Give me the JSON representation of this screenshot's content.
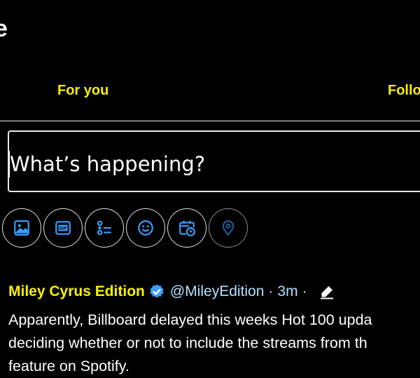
{
  "header": {
    "title": "e"
  },
  "tabs": [
    {
      "label": "For you"
    },
    {
      "label": "Follo"
    }
  ],
  "compose": {
    "placeholder": "What’s happening?",
    "toolbar": [
      {
        "icon": "image-icon",
        "label": "Media"
      },
      {
        "icon": "gif-icon",
        "label": "GIF"
      },
      {
        "icon": "poll-icon",
        "label": "Poll"
      },
      {
        "icon": "emoji-icon",
        "label": "Emoji"
      },
      {
        "icon": "schedule-icon",
        "label": "Schedule"
      },
      {
        "icon": "location-icon",
        "label": "Location"
      }
    ]
  },
  "tweet": {
    "name": "Miley Cyrus Edition",
    "verified": true,
    "handle": "@MileyEdition",
    "separator": "·",
    "time": "3m",
    "text_lines": [
      "Apparently, Billboard delayed this weeks Hot 100 upda",
      "deciding whether or not to include the streams from th",
      "feature on Spotify."
    ]
  },
  "colors": {
    "background": "#000000",
    "accent": "#f7f000",
    "link": "#b0e0ff",
    "icon": "#3aa0ff",
    "border": "#e9e9e9"
  }
}
